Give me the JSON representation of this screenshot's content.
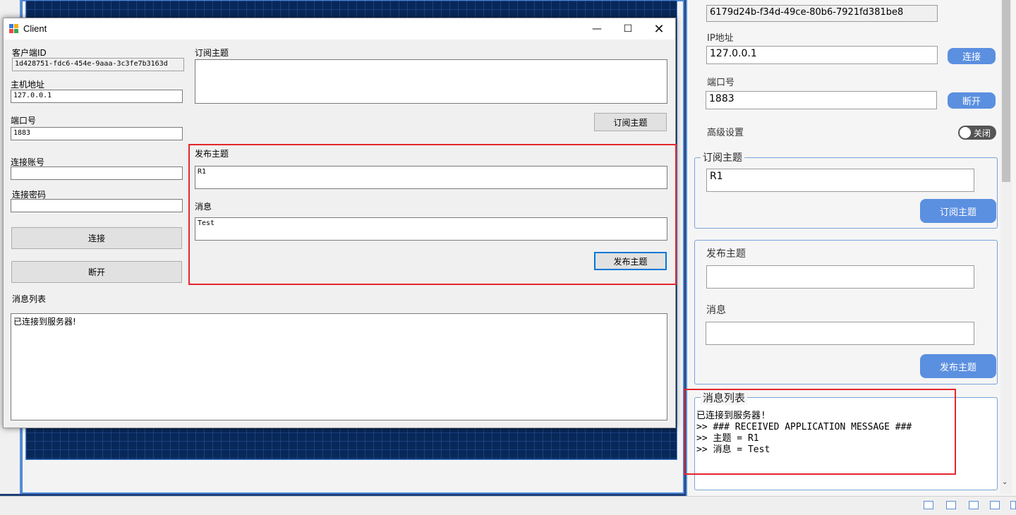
{
  "client": {
    "title": "Client",
    "client_id_label": "客户端ID",
    "client_id_value": "1d428751-fdc6-454e-9aaa-3c3fe7b3163d",
    "host_label": "主机地址",
    "host_value": "127.0.0.1",
    "port_label": "端口号",
    "port_value": "1883",
    "account_label": "连接账号",
    "account_value": "",
    "password_label": "连接密码",
    "password_value": "",
    "connect_button": "连接",
    "disconnect_button": "断开",
    "subscribe_topic_label": "订阅主题",
    "subscribe_topic_value": "",
    "subscribe_button": "订阅主题",
    "publish_topic_label": "发布主题",
    "publish_topic_value": "R1",
    "message_label": "消息",
    "message_value": "Test",
    "publish_button": "发布主题",
    "message_list_label": "消息列表",
    "message_list_text": "已连接到服务器!"
  },
  "server_panel": {
    "client_id_value": "6179d24b-f34d-49ce-80b6-7921fd381be8",
    "ip_label": "IP地址",
    "ip_value": "127.0.0.1",
    "connect_button": "连接",
    "port_label": "端口号",
    "port_value": "1883",
    "disconnect_button": "断开",
    "advanced_label": "高级设置",
    "advanced_toggle": "关闭",
    "subscribe_group": "订阅主题",
    "subscribe_topic_value": "R1",
    "subscribe_button": "订阅主题",
    "publish_topic_label": "发布主题",
    "publish_topic_value": "",
    "message_label": "消息",
    "message_value": "",
    "publish_button": "发布主题",
    "message_list_group": "消息列表",
    "log_lines": [
      "已连接到服务器!",
      ">> ### RECEIVED APPLICATION MESSAGE ###",
      ">> 主题 = R1",
      ">> 消息 = Test"
    ]
  },
  "colors": {
    "accent_blue": "#5b8fe0",
    "highlight_red": "#e5262d"
  }
}
